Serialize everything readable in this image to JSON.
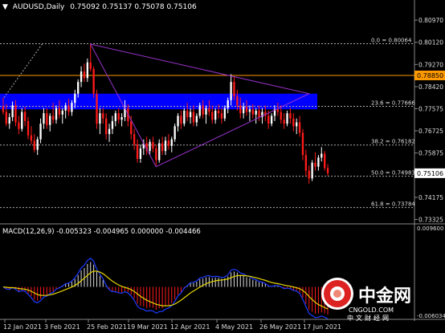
{
  "header": {
    "symbol": "AUDUSD,Daily",
    "ohlc": "0.75092 0.75137 0.75078 0.75106"
  },
  "macd": {
    "header": "MACD(12,26,9) -0.005323 -0.004965 0.000000 -0.004466"
  },
  "watermark": {
    "brand": "中金网",
    "site": "CNGOLD.COM",
    "tagline": "中文财经网"
  },
  "colors": {
    "background": "#000000",
    "bull": "#FFFFFF",
    "bear": "#FF1A1A",
    "fib": "#AAAAAA",
    "triangle": "#9933CC",
    "zone": "#0000FF",
    "resistance": "#FF9900",
    "signal": "#E6D600",
    "macd_line": "#1E3CFF"
  },
  "chart_data": {
    "type": "candlestick",
    "instrument": "AUDUSD",
    "timeframe": "Daily",
    "x_labels": [
      "12 Jan 2021",
      "3 Feb 2021",
      "25 Feb 2021",
      "19 Mar 2021",
      "12 Apr 2021",
      "4 May 2021",
      "26 May 2021",
      "17 Jun 2021"
    ],
    "price_axis": {
      "ticks": [
        "0.80970",
        "0.80120",
        "0.79270",
        "0.78420",
        "0.77575",
        "0.76725",
        "0.75875",
        "0.75025",
        "0.74175",
        "0.73325"
      ],
      "ylim": [
        0.7325,
        0.8125
      ]
    },
    "last_price_label": "0.75106",
    "resistance": {
      "value": 0.7885,
      "label": "0.78850"
    },
    "fib_levels": [
      {
        "label": "0.0 = 0.80064",
        "value": 0.80064
      },
      {
        "label": "23.6 = 0.77666",
        "value": 0.77666
      },
      {
        "label": "38.2 = 0.76182",
        "value": 0.76182
      },
      {
        "label": "50.0 = 0.74983",
        "value": 0.74983
      },
      {
        "label": "61.8 = 0.73784",
        "value": 0.73784
      }
    ],
    "zone": {
      "low": 0.7755,
      "high": 0.7815
    },
    "triangle": [
      {
        "i": 28,
        "p": 0.8005
      },
      {
        "i": 98,
        "p": 0.7815
      },
      {
        "i": 49,
        "p": 0.7535
      }
    ],
    "candles": [
      [
        0.7765,
        0.78,
        0.7735,
        0.7745
      ],
      [
        0.7745,
        0.7775,
        0.769,
        0.77
      ],
      [
        0.77,
        0.774,
        0.768,
        0.7725
      ],
      [
        0.7725,
        0.7785,
        0.771,
        0.777
      ],
      [
        0.777,
        0.779,
        0.769,
        0.7705
      ],
      [
        0.7705,
        0.773,
        0.766,
        0.768
      ],
      [
        0.768,
        0.776,
        0.767,
        0.7745
      ],
      [
        0.7745,
        0.7765,
        0.769,
        0.771
      ],
      [
        0.771,
        0.7725,
        0.764,
        0.7655
      ],
      [
        0.7655,
        0.769,
        0.762,
        0.7635
      ],
      [
        0.7635,
        0.766,
        0.759,
        0.76
      ],
      [
        0.76,
        0.765,
        0.758,
        0.764
      ],
      [
        0.764,
        0.772,
        0.7625,
        0.77
      ],
      [
        0.77,
        0.776,
        0.768,
        0.774
      ],
      [
        0.774,
        0.776,
        0.768,
        0.7695
      ],
      [
        0.7695,
        0.774,
        0.767,
        0.773
      ],
      [
        0.773,
        0.778,
        0.77,
        0.7715
      ],
      [
        0.7715,
        0.777,
        0.77,
        0.776
      ],
      [
        0.776,
        0.779,
        0.772,
        0.7735
      ],
      [
        0.7735,
        0.776,
        0.77,
        0.775
      ],
      [
        0.775,
        0.778,
        0.772,
        0.777
      ],
      [
        0.777,
        0.7795,
        0.773,
        0.7745
      ],
      [
        0.7745,
        0.779,
        0.773,
        0.778
      ],
      [
        0.778,
        0.783,
        0.776,
        0.7815
      ],
      [
        0.7815,
        0.787,
        0.78,
        0.786
      ],
      [
        0.786,
        0.792,
        0.784,
        0.79
      ],
      [
        0.79,
        0.793,
        0.786,
        0.7875
      ],
      [
        0.7875,
        0.795,
        0.786,
        0.7935
      ],
      [
        0.7935,
        0.8007,
        0.79,
        0.791
      ],
      [
        0.791,
        0.792,
        0.78,
        0.7815
      ],
      [
        0.7815,
        0.783,
        0.768,
        0.77
      ],
      [
        0.77,
        0.776,
        0.766,
        0.774
      ],
      [
        0.774,
        0.776,
        0.77,
        0.772
      ],
      [
        0.772,
        0.774,
        0.764,
        0.766
      ],
      [
        0.766,
        0.77,
        0.763,
        0.768
      ],
      [
        0.768,
        0.773,
        0.766,
        0.771
      ],
      [
        0.771,
        0.775,
        0.769,
        0.774
      ],
      [
        0.774,
        0.776,
        0.77,
        0.7715
      ],
      [
        0.7715,
        0.774,
        0.769,
        0.7725
      ],
      [
        0.7725,
        0.779,
        0.771,
        0.776
      ],
      [
        0.776,
        0.7775,
        0.769,
        0.771
      ],
      [
        0.771,
        0.773,
        0.764,
        0.766
      ],
      [
        0.766,
        0.768,
        0.76,
        0.762
      ],
      [
        0.762,
        0.764,
        0.755,
        0.7565
      ],
      [
        0.7565,
        0.762,
        0.755,
        0.7605
      ],
      [
        0.7605,
        0.764,
        0.758,
        0.7625
      ],
      [
        0.7625,
        0.765,
        0.758,
        0.7595
      ],
      [
        0.7595,
        0.764,
        0.758,
        0.763
      ],
      [
        0.763,
        0.765,
        0.759,
        0.7605
      ],
      [
        0.7605,
        0.762,
        0.754,
        0.756
      ],
      [
        0.756,
        0.764,
        0.755,
        0.7625
      ],
      [
        0.7625,
        0.765,
        0.758,
        0.7595
      ],
      [
        0.7595,
        0.765,
        0.758,
        0.7635
      ],
      [
        0.7635,
        0.766,
        0.76,
        0.7615
      ],
      [
        0.7615,
        0.765,
        0.759,
        0.764
      ],
      [
        0.764,
        0.77,
        0.763,
        0.769
      ],
      [
        0.769,
        0.774,
        0.767,
        0.773
      ],
      [
        0.773,
        0.775,
        0.768,
        0.77
      ],
      [
        0.77,
        0.776,
        0.769,
        0.775
      ],
      [
        0.775,
        0.778,
        0.771,
        0.7725
      ],
      [
        0.7725,
        0.776,
        0.77,
        0.7745
      ],
      [
        0.7745,
        0.777,
        0.769,
        0.7705
      ],
      [
        0.7705,
        0.774,
        0.769,
        0.773
      ],
      [
        0.773,
        0.778,
        0.772,
        0.777
      ],
      [
        0.777,
        0.779,
        0.772,
        0.7735
      ],
      [
        0.7735,
        0.777,
        0.77,
        0.776
      ],
      [
        0.776,
        0.779,
        0.773,
        0.7745
      ],
      [
        0.7745,
        0.777,
        0.77,
        0.7715
      ],
      [
        0.7715,
        0.776,
        0.77,
        0.775
      ],
      [
        0.775,
        0.7775,
        0.772,
        0.774
      ],
      [
        0.774,
        0.776,
        0.77,
        0.772
      ],
      [
        0.772,
        0.777,
        0.771,
        0.776
      ],
      [
        0.776,
        0.78,
        0.774,
        0.779
      ],
      [
        0.779,
        0.789,
        0.777,
        0.786
      ],
      [
        0.786,
        0.788,
        0.779,
        0.7805
      ],
      [
        0.7805,
        0.783,
        0.775,
        0.777
      ],
      [
        0.777,
        0.78,
        0.772,
        0.774
      ],
      [
        0.774,
        0.778,
        0.772,
        0.7765
      ],
      [
        0.7765,
        0.779,
        0.773,
        0.7745
      ],
      [
        0.7745,
        0.777,
        0.771,
        0.7755
      ],
      [
        0.7755,
        0.7775,
        0.772,
        0.7735
      ],
      [
        0.7735,
        0.776,
        0.77,
        0.775
      ],
      [
        0.775,
        0.777,
        0.771,
        0.7725
      ],
      [
        0.7725,
        0.776,
        0.77,
        0.7745
      ],
      [
        0.7745,
        0.777,
        0.771,
        0.773
      ],
      [
        0.773,
        0.775,
        0.768,
        0.77
      ],
      [
        0.77,
        0.774,
        0.769,
        0.773
      ],
      [
        0.773,
        0.777,
        0.771,
        0.7755
      ],
      [
        0.7755,
        0.778,
        0.773,
        0.7745
      ],
      [
        0.7745,
        0.777,
        0.77,
        0.7715
      ],
      [
        0.7715,
        0.774,
        0.768,
        0.77
      ],
      [
        0.77,
        0.775,
        0.769,
        0.774
      ],
      [
        0.774,
        0.776,
        0.77,
        0.772
      ],
      [
        0.772,
        0.774,
        0.767,
        0.769
      ],
      [
        0.769,
        0.772,
        0.766,
        0.7705
      ],
      [
        0.7705,
        0.773,
        0.765,
        0.7665
      ],
      [
        0.7665,
        0.768,
        0.756,
        0.758
      ],
      [
        0.758,
        0.76,
        0.75,
        0.752
      ],
      [
        0.752,
        0.754,
        0.747,
        0.749
      ],
      [
        0.749,
        0.756,
        0.748,
        0.755
      ],
      [
        0.755,
        0.759,
        0.752,
        0.7535
      ],
      [
        0.7535,
        0.758,
        0.752,
        0.757
      ],
      [
        0.757,
        0.761,
        0.7555,
        0.7585
      ],
      [
        0.7585,
        0.7595,
        0.752,
        0.753
      ],
      [
        0.753,
        0.7545,
        0.75,
        0.751
      ]
    ]
  }
}
